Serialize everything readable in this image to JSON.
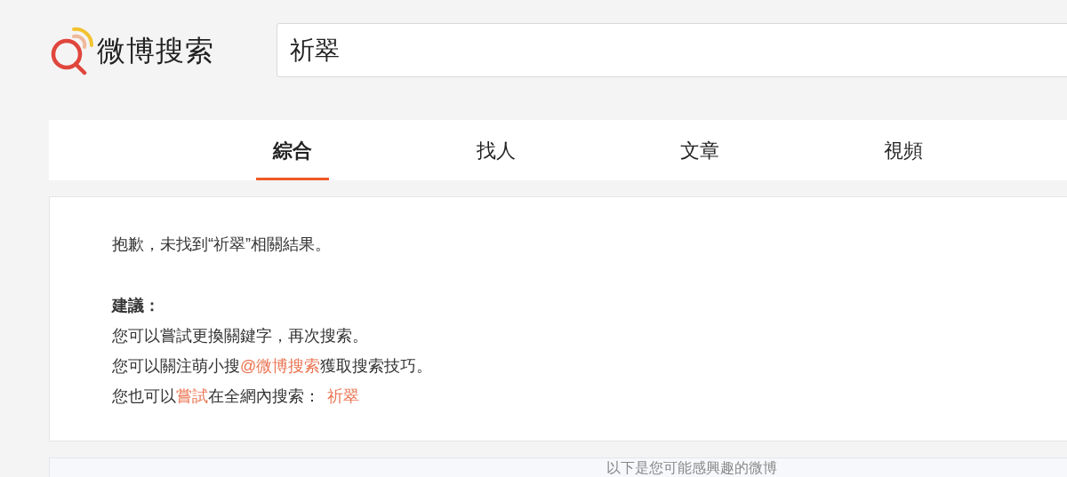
{
  "logo": {
    "text": "微博搜索"
  },
  "search": {
    "value": "祈翠"
  },
  "tabs": [
    {
      "label": "綜合",
      "selected": true
    },
    {
      "label": "找人",
      "selected": false
    },
    {
      "label": "文章",
      "selected": false
    },
    {
      "label": "視頻",
      "selected": false
    }
  ],
  "result": {
    "message": "抱歉，未找到“祈翠”相關結果。",
    "suggestion_title": "建議：",
    "suggestions": [
      [
        {
          "kind": "text",
          "text": "您可以嘗試更換關鍵字，再次搜索。"
        }
      ],
      [
        {
          "kind": "text",
          "text": "您可以關注萌小搜"
        },
        {
          "kind": "link",
          "text": "@微博搜索"
        },
        {
          "kind": "text",
          "text": "獲取搜索技巧。"
        }
      ],
      [
        {
          "kind": "text",
          "text": "您也可以"
        },
        {
          "kind": "link",
          "text": "嘗試"
        },
        {
          "kind": "text",
          "text": "在全網內搜索："
        },
        {
          "kind": "link",
          "text": "祈翠"
        }
      ]
    ]
  },
  "related_banner": {
    "text": "以下是您可能感興趣的微博"
  }
}
